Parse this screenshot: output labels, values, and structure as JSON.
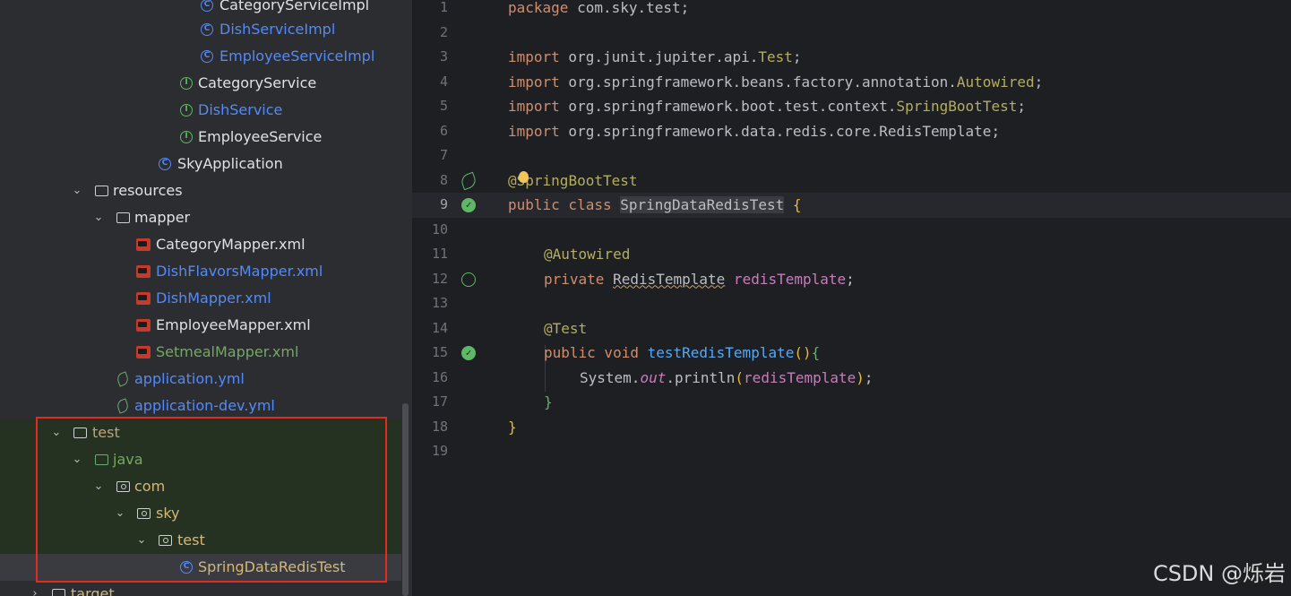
{
  "project_tree": {
    "items": [
      {
        "label": "CategoryServiceImpl",
        "color": "c-norm"
      },
      {
        "label": "DishServiceImpl",
        "color": "c-blue"
      },
      {
        "label": "EmployeeServiceImpl",
        "color": "c-blue"
      },
      {
        "label": "CategoryService",
        "color": "c-norm"
      },
      {
        "label": "DishService",
        "color": "c-blue"
      },
      {
        "label": "EmployeeService",
        "color": "c-norm"
      },
      {
        "label": "SkyApplication",
        "color": "c-norm"
      },
      {
        "label": "resources",
        "color": "c-norm"
      },
      {
        "label": "mapper",
        "color": "c-norm"
      },
      {
        "label": "CategoryMapper.xml",
        "color": "c-norm"
      },
      {
        "label": "DishFlavorsMapper.xml",
        "color": "c-blue"
      },
      {
        "label": "DishMapper.xml",
        "color": "c-blue"
      },
      {
        "label": "EmployeeMapper.xml",
        "color": "c-norm"
      },
      {
        "label": "SetmealMapper.xml",
        "color": "c-green"
      },
      {
        "label": "application.yml",
        "color": "c-blue"
      },
      {
        "label": "application-dev.yml",
        "color": "c-blue"
      },
      {
        "label": "test",
        "color": "c-test"
      },
      {
        "label": "java",
        "color": "c-green"
      },
      {
        "label": "com",
        "color": "c-orange"
      },
      {
        "label": "sky",
        "color": "c-orange"
      },
      {
        "label": "test",
        "color": "c-orange"
      },
      {
        "label": "SpringDataRedisTest",
        "color": "c-orange"
      },
      {
        "label": "target",
        "color": "c-orange"
      }
    ]
  },
  "editor": {
    "line_numbers": [
      "1",
      "2",
      "3",
      "4",
      "5",
      "6",
      "7",
      "8",
      "9",
      "10",
      "11",
      "12",
      "13",
      "14",
      "15",
      "16",
      "17",
      "18",
      "19"
    ],
    "code": {
      "l1_kw": "package",
      "l1_rest": " com.sky.test;",
      "l3_kw": "import",
      "l3_a": " org.junit.jupiter.api.",
      "l3_b": "Test",
      "l3_c": ";",
      "l4_kw": "import",
      "l4_a": " org.springframework.beans.factory.annotation.",
      "l4_b": "Autowired",
      "l4_c": ";",
      "l5_kw": "import",
      "l5_a": " org.springframework.boot.test.context.",
      "l5_b": "SpringBootTest",
      "l5_c": ";",
      "l6_kw": "import",
      "l6_a": " org.springframework.data.redis.core.RedisTemplate;",
      "l8_a": "@",
      "l8_b": "SpringBootTest",
      "l9_kw": "public class ",
      "l9_cls": "SpringDataRedisTest",
      "l9_brace": " {",
      "l11_ann": "@Autowired",
      "l12_kw": "private ",
      "l12_type": "RedisTemplate",
      "l12_fld": " redisTemplate",
      "l12_end": ";",
      "l14_ann": "@Test",
      "l15_kw": "public void ",
      "l15_fn": "testRedisTemplate",
      "l15_p": "()",
      "l15_b": "{",
      "l16_a": "System.",
      "l16_out": "out",
      "l16_b": ".println",
      "l16_p1": "(",
      "l16_fld": "redisTemplate",
      "l16_p2": ")",
      "l16_end": ";",
      "l17_b": "}",
      "l18_b": "}"
    }
  },
  "watermark": "CSDN @烁岩"
}
